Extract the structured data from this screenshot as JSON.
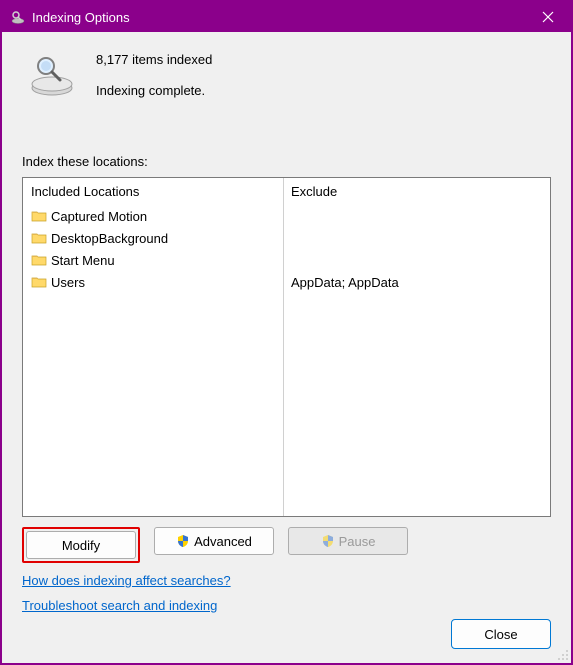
{
  "window": {
    "title": "Indexing Options"
  },
  "status": {
    "count_text": "8,177 items indexed",
    "state_text": "Indexing complete."
  },
  "locations_label": "Index these locations:",
  "columns": {
    "included_header": "Included Locations",
    "exclude_header": "Exclude"
  },
  "locations": [
    {
      "name": "Captured Motion",
      "exclude": ""
    },
    {
      "name": "DesktopBackground",
      "exclude": ""
    },
    {
      "name": "Start Menu",
      "exclude": ""
    },
    {
      "name": "Users",
      "exclude": "AppData; AppData"
    }
  ],
  "buttons": {
    "modify": "Modify",
    "advanced": "Advanced",
    "pause": "Pause",
    "close": "Close"
  },
  "links": {
    "how_affect": "How does indexing affect searches?",
    "troubleshoot": "Troubleshoot search and indexing"
  }
}
